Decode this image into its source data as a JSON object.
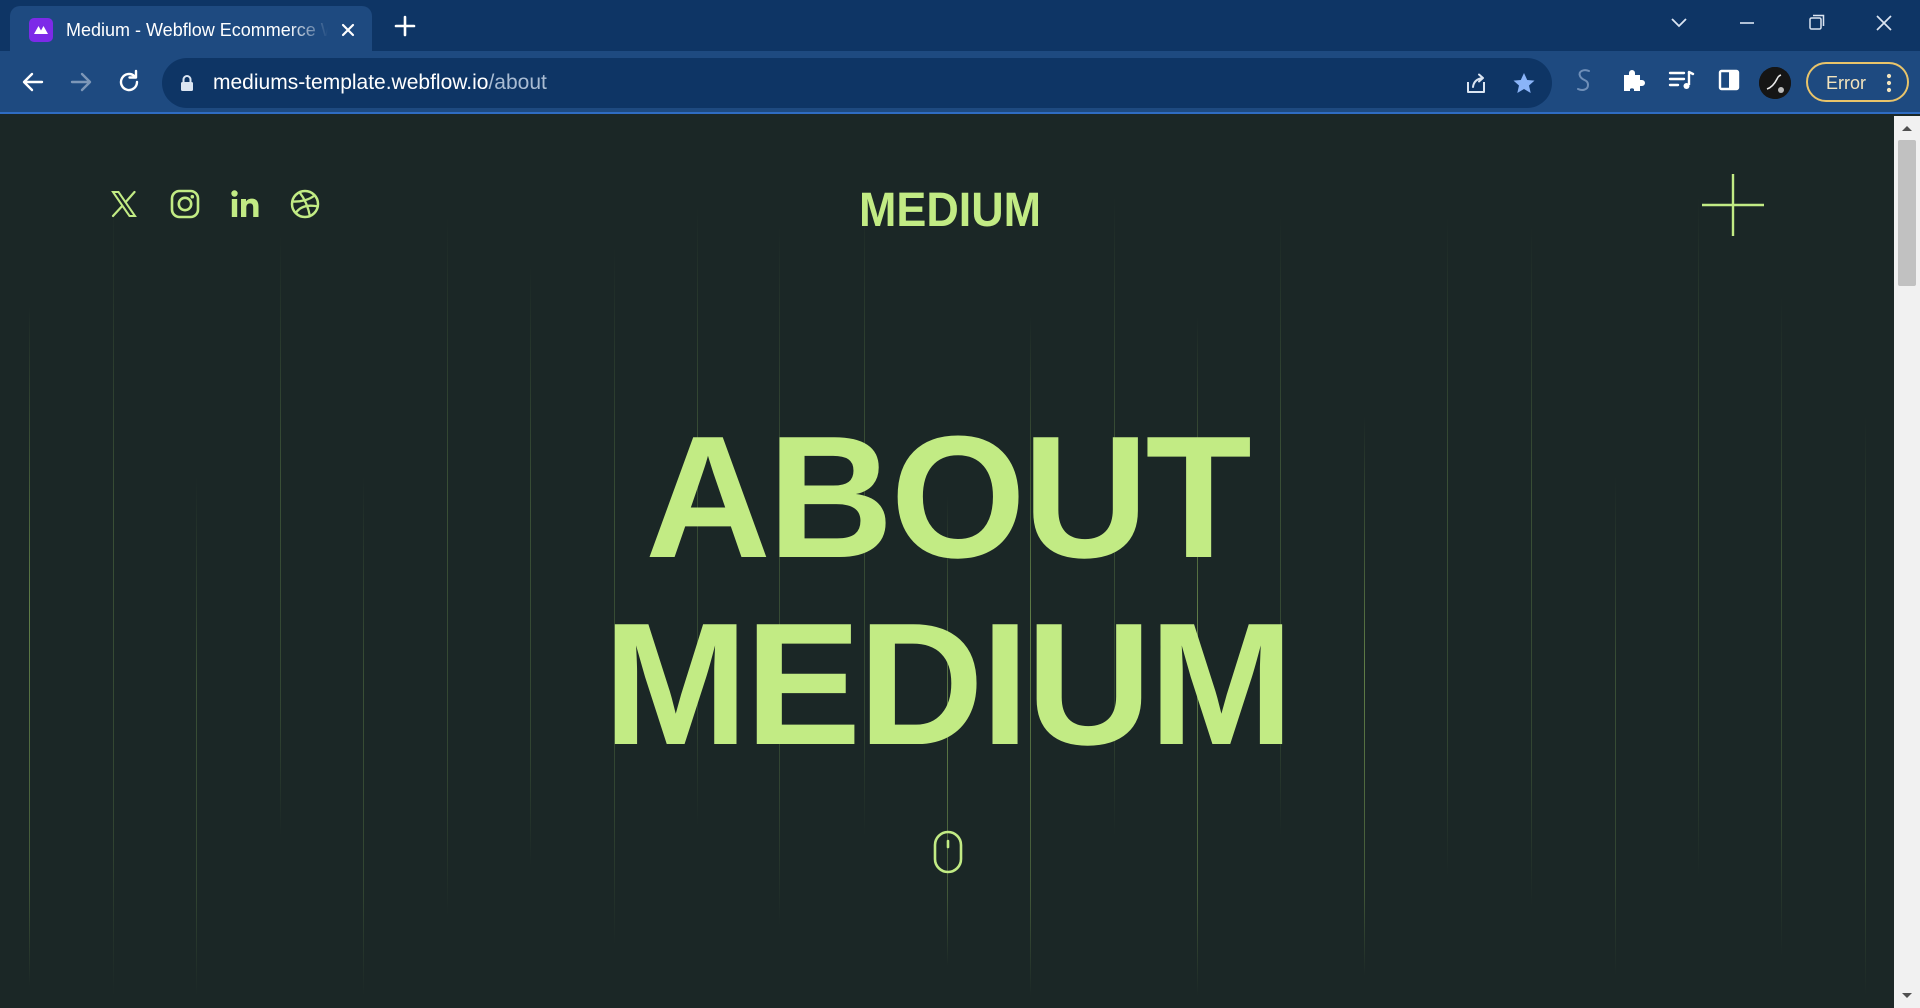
{
  "browser": {
    "tab_title": "Medium - Webflow Ecommerce Website Template",
    "url_host": "mediums-template.webflow.io",
    "url_path": "/about",
    "profile_status": "Error",
    "colors": {
      "frame": "#0e3565",
      "toolbar": "#1e4a80",
      "error_outline": "#e9c46a"
    }
  },
  "site": {
    "logo_text": "MEDIUM",
    "social_links": [
      "x-twitter-icon",
      "instagram-icon",
      "linkedin-icon",
      "dribbble-icon"
    ],
    "hero": {
      "line1": "ABOUT",
      "line2": "MEDIUM"
    },
    "colors": {
      "background": "#1b2726",
      "accent": "#c2eb84"
    }
  }
}
